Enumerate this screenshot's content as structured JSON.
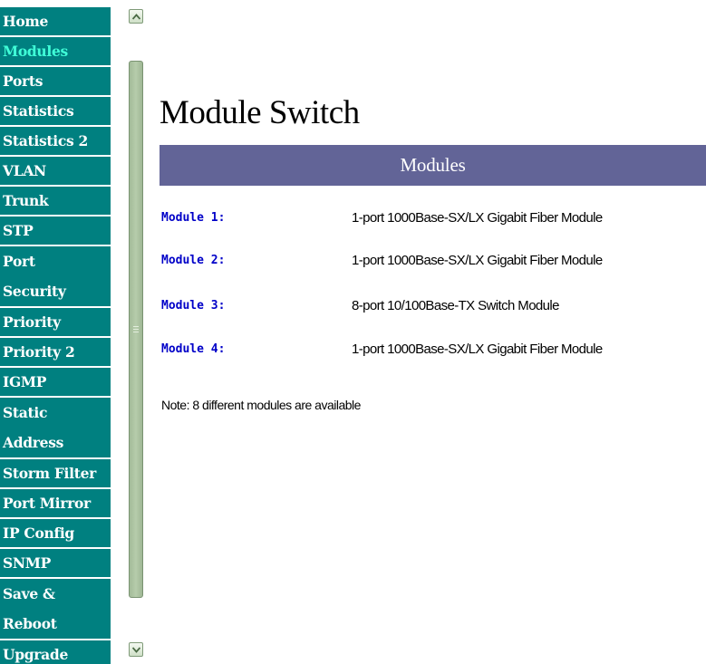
{
  "nav": {
    "items": [
      {
        "label": "Home",
        "lines": [
          "Home"
        ],
        "active": false
      },
      {
        "label": "Modules",
        "lines": [
          "Modules"
        ],
        "active": true
      },
      {
        "label": "Ports",
        "lines": [
          "Ports"
        ],
        "active": false
      },
      {
        "label": "Statistics",
        "lines": [
          "Statistics"
        ],
        "active": false
      },
      {
        "label": "Statistics 2",
        "lines": [
          "Statistics 2"
        ],
        "active": false
      },
      {
        "label": "VLAN",
        "lines": [
          "VLAN"
        ],
        "active": false
      },
      {
        "label": "Trunk",
        "lines": [
          "Trunk"
        ],
        "active": false
      },
      {
        "label": "STP",
        "lines": [
          "STP"
        ],
        "active": false
      },
      {
        "label": "Port Security",
        "lines": [
          "Port",
          "Security"
        ],
        "active": false
      },
      {
        "label": "Priority",
        "lines": [
          "Priority"
        ],
        "active": false
      },
      {
        "label": "Priority 2",
        "lines": [
          "Priority 2"
        ],
        "active": false
      },
      {
        "label": "IGMP",
        "lines": [
          "IGMP"
        ],
        "active": false
      },
      {
        "label": "Static Address",
        "lines": [
          "Static",
          "Address"
        ],
        "active": false
      },
      {
        "label": "Storm Filter",
        "lines": [
          "Storm Filter"
        ],
        "active": false
      },
      {
        "label": "Port Mirror",
        "lines": [
          "Port Mirror"
        ],
        "active": false
      },
      {
        "label": "IP Config",
        "lines": [
          "IP Config"
        ],
        "active": false
      },
      {
        "label": "SNMP",
        "lines": [
          "SNMP"
        ],
        "active": false
      },
      {
        "label": "Save & Reboot",
        "lines": [
          "Save &",
          "Reboot"
        ],
        "active": false
      },
      {
        "label": "Upgrade",
        "lines": [
          "Upgrade"
        ],
        "active": false
      }
    ]
  },
  "main": {
    "title": "Module Switch",
    "section_header": "Modules",
    "modules": [
      {
        "name": "Module 1:",
        "description": "1-port 1000Base-SX/LX Gigabit Fiber Module"
      },
      {
        "name": "Module 2:",
        "description": "1-port 1000Base-SX/LX Gigabit Fiber Module"
      },
      {
        "name": "Module 3:",
        "description": "8-port 10/100Base-TX Switch Module"
      },
      {
        "name": "Module 4:",
        "description": "1-port 1000Base-SX/LX Gigabit Fiber Module"
      }
    ],
    "note": "Note: 8 different modules are available"
  },
  "colors": {
    "nav_background": "#008080",
    "nav_active_text": "#40ffd8",
    "section_header_background": "#626497",
    "module_link": "#0000c8"
  },
  "icons": {
    "scroll_up": "chevron-up-icon",
    "scroll_down": "chevron-down-icon"
  }
}
